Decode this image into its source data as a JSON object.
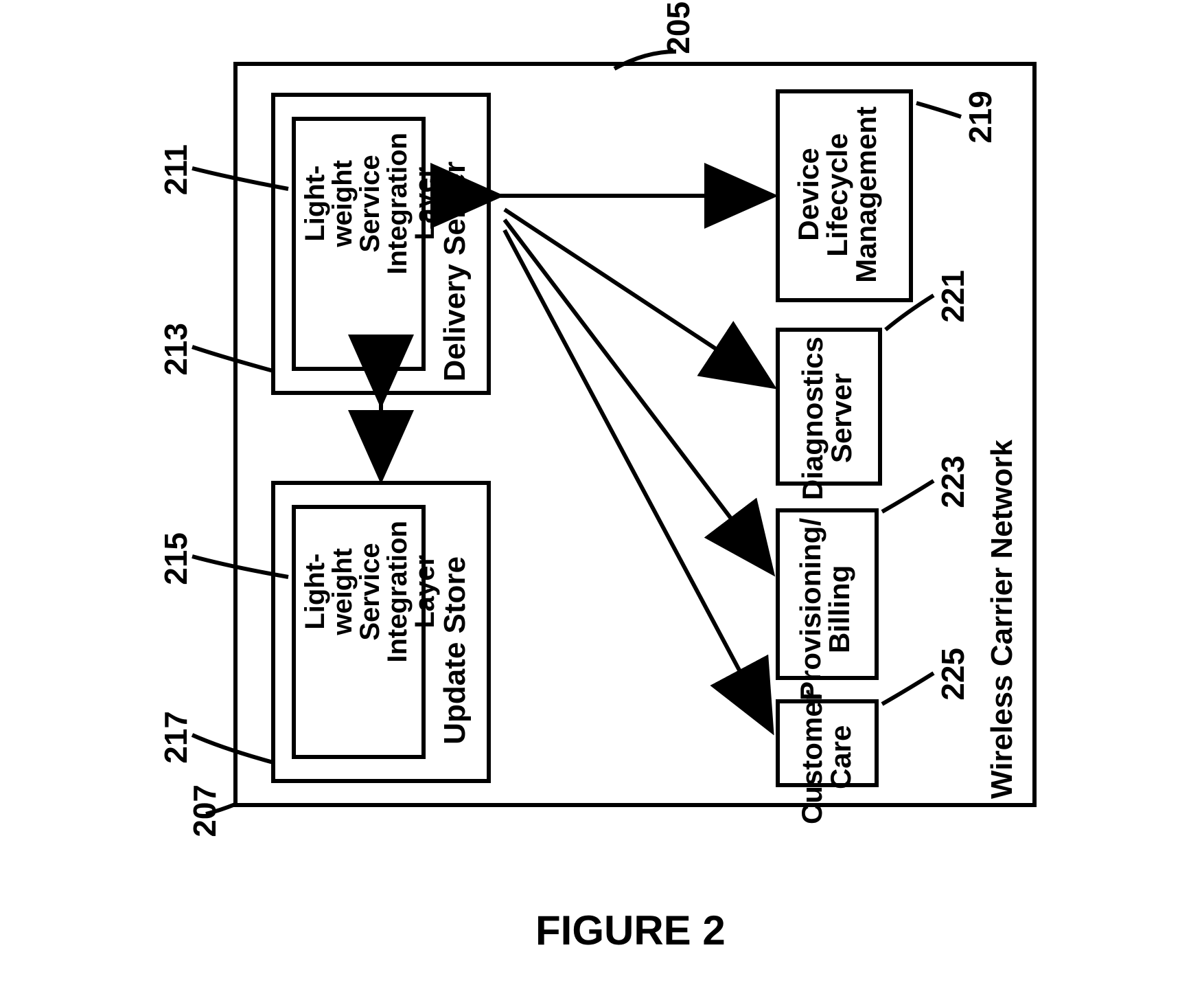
{
  "figure_label": "FIGURE 2",
  "outer": {
    "ref": "205",
    "container_label": "Wireless Carrier Network",
    "container_ref": "207"
  },
  "delivery_server": {
    "label": "Delivery Server",
    "ref": "213",
    "inner": {
      "label": "Light-\nweight\nService\nIntegration\nLayer",
      "ref": "211"
    }
  },
  "update_store": {
    "label": "Update Store",
    "ref": "217",
    "inner": {
      "label": "Light-\nweight\nService\nIntegration\nLayer",
      "ref": "215"
    }
  },
  "right_blocks": [
    {
      "label": "Device\nLifecycle\nManagement",
      "ref": "219"
    },
    {
      "label": "Diagnostics\nServer",
      "ref": "221"
    },
    {
      "label": "Provisioning/\nBilling",
      "ref": "223"
    },
    {
      "label": "Customer\nCare",
      "ref": "225"
    }
  ]
}
